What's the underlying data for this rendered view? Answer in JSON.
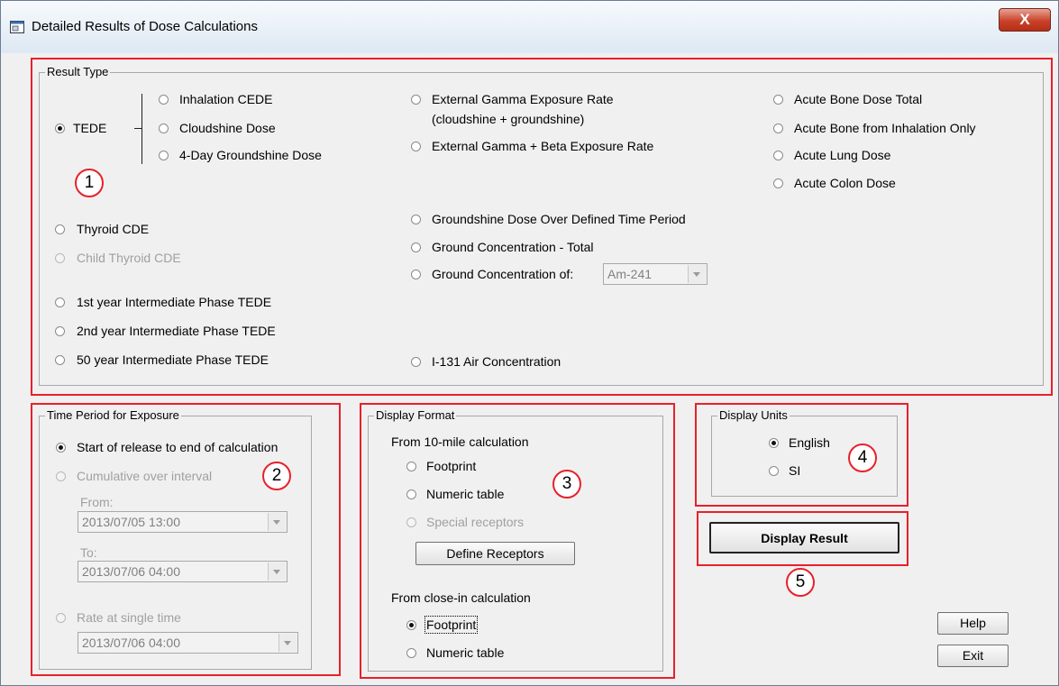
{
  "window": {
    "title": "Detailed Results of Dose Calculations",
    "close_label": "X"
  },
  "result_type": {
    "legend": "Result Type",
    "tede": "TEDE",
    "inhalation_cede": "Inhalation CEDE",
    "cloudshine_dose": "Cloudshine Dose",
    "groundshine_4day": "4-Day Groundshine Dose",
    "ext_gamma_line1": "External Gamma Exposure Rate",
    "ext_gamma_line2": "(cloudshine + groundshine)",
    "ext_gamma_beta": "External Gamma + Beta Exposure Rate",
    "acute_bone_total": "Acute Bone Dose Total",
    "acute_bone_inhal": "Acute Bone from Inhalation Only",
    "acute_lung": "Acute Lung Dose",
    "acute_colon": "Acute Colon Dose",
    "thyroid_cde": "Thyroid CDE",
    "child_thyroid_cde": "Child Thyroid CDE",
    "groundshine_defined": "Groundshine Dose Over Defined Time Period",
    "ground_conc_total": "Ground Concentration - Total",
    "ground_conc_of": "Ground Concentration of:",
    "isotope_value": "Am-241",
    "year1": "1st year Intermediate Phase TEDE",
    "year2": "2nd year Intermediate Phase TEDE",
    "year50": "50 year Intermediate Phase TEDE",
    "i131": "I-131 Air Concentration"
  },
  "time_period": {
    "legend": "Time Period for Exposure",
    "start_to_end": "Start of release to end of calculation",
    "cumulative": "Cumulative over interval",
    "from_label": "From:",
    "from_value": "2013/07/05 13:00",
    "to_label": "To:",
    "to_value": "2013/07/06 04:00",
    "rate_single": "Rate at single time",
    "rate_value": "2013/07/06 04:00"
  },
  "display_format": {
    "legend": "Display Format",
    "from_10mile": "From 10-mile calculation",
    "footprint": "Footprint",
    "numeric_table": "Numeric table",
    "special_receptors": "Special receptors",
    "define_receptors": "Define Receptors",
    "from_closein": "From close-in calculation",
    "footprint2": "Footprint",
    "numeric_table2": "Numeric table"
  },
  "display_units": {
    "legend": "Display Units",
    "english": "English",
    "si": "SI"
  },
  "buttons": {
    "display_result": "Display Result",
    "help": "Help",
    "exit": "Exit"
  },
  "callouts": [
    "1",
    "2",
    "3",
    "4",
    "5"
  ],
  "colors": {
    "highlight_red": "#e8202a",
    "dialog_bg": "#f0f0f0",
    "disabled_text": "#a0a0a0"
  }
}
